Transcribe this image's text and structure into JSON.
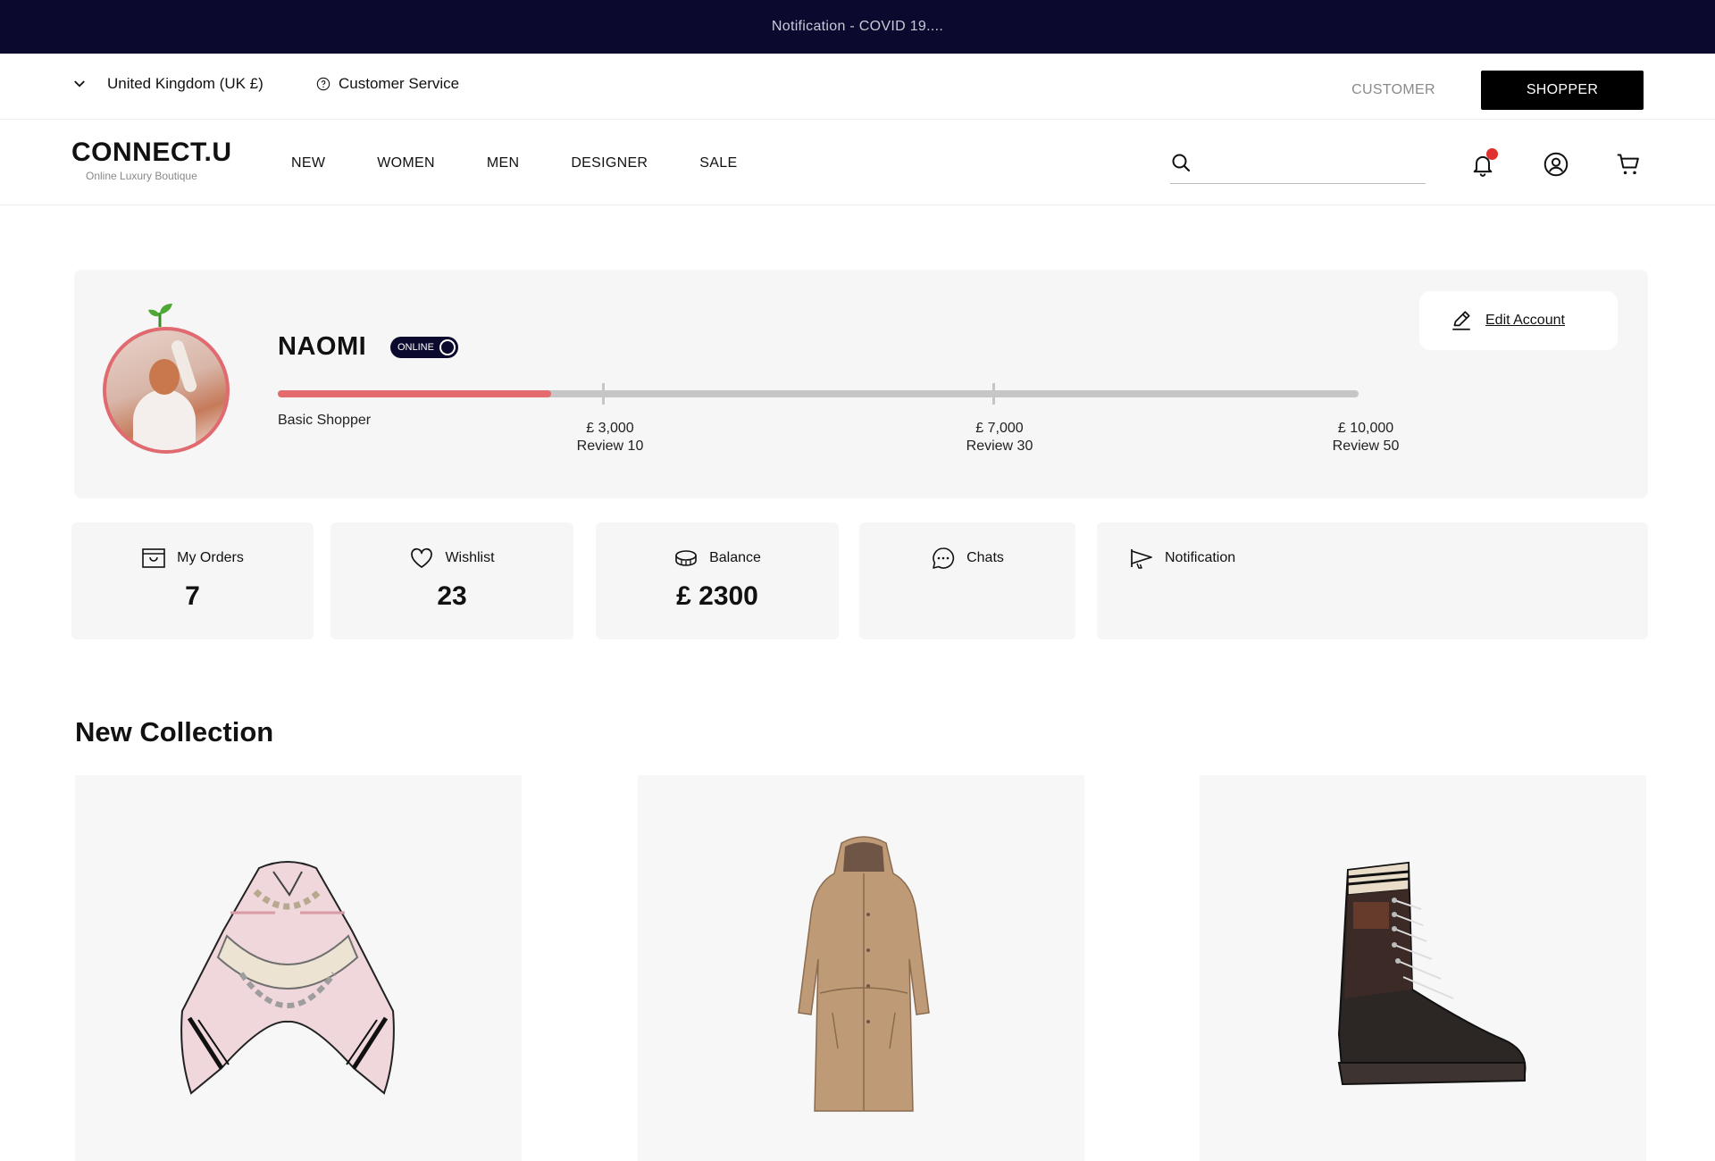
{
  "notification_bar": {
    "text": "Notification - COVID 19...."
  },
  "utility_bar": {
    "country": "United Kingdom (UK £)",
    "customer_service": "Customer Service",
    "customer_label": "CUSTOMER",
    "shopper_label": "SHOPPER"
  },
  "header": {
    "brand": "CONNECT.U",
    "tagline": "Online Luxury Boutique",
    "nav": [
      "NEW",
      "WOMEN",
      "MEN",
      "DESIGNER",
      "SALE"
    ],
    "search_placeholder": ""
  },
  "profile": {
    "name": "NAOMI",
    "status": "ONLINE",
    "level": "Basic Shopper",
    "progress": 0.253,
    "edit_label": "Edit Account",
    "milestones": [
      {
        "amount": "£ 3,000",
        "review": "Review 10"
      },
      {
        "amount": "£ 7,000",
        "review": "Review 30"
      },
      {
        "amount": "£ 10,000",
        "review": "Review 50"
      }
    ]
  },
  "stats": {
    "orders_label": "My Orders",
    "orders_value": "7",
    "wishlist_label": "Wishlist",
    "wishlist_value": "23",
    "balance_label": "Balance",
    "balance_value": "£ 2300",
    "chats_label": "Chats",
    "notification_label": "Notification"
  },
  "collection": {
    "title": "New Collection",
    "products": [
      "silk-scarf",
      "hooded-trench-coat",
      "lace-up-combat-boot"
    ]
  },
  "colors": {
    "accent": "#e46b6e",
    "dark": "#0b0a2e",
    "bell_dot": "#e0302f"
  }
}
